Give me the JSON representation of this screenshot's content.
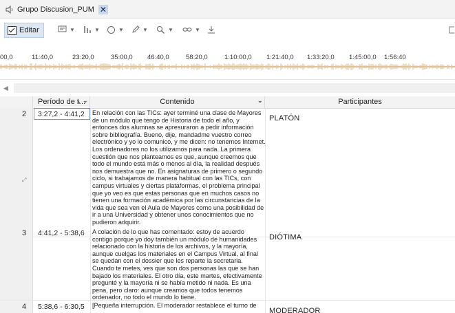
{
  "tab": {
    "title": "Grupo Discusion_PUM",
    "close": "✕"
  },
  "toolbar": {
    "edit_label": "Editar",
    "edit_checked": true,
    "icons": [
      "comment-icon",
      "bars-icon",
      "circle-icon",
      "pen-icon",
      "zoom-icon",
      "link-icon",
      "download-icon"
    ]
  },
  "timeline": {
    "ticks": [
      "00,0",
      "11:40,0",
      "23:20,0",
      "35:00,0",
      "46:40,0",
      "58:20,0",
      "1:10:00,0",
      "1:21:40,0",
      "1:33:20,0",
      "1:45:00,0",
      "1:56:40"
    ]
  },
  "table": {
    "headers": {
      "num": "",
      "period": "Período de t...",
      "content": "Contenido",
      "participants": "Participantes"
    },
    "rows": [
      {
        "num": "2",
        "period": "3:27,2 - 4:41,2",
        "content": "En relación con las TICs: ayer terminé una clase de Mayores de un módulo que tengo de Historia de todo el año, y entonces dos alumnas se apresuraron a pedir información sobre bibliografía. Bueno, dije, mandadme vuestro correo electrónico y yo lo comunico, y me dicen: no tenemos Internet. Los ordenadores no los utilizamos para nada. La primera cuestión que nos planteamos es que, aunque creemos que todo el mundo está más o menos al día, la realidad después nos demuestra que no. En asignaturas de primero o segundo ciclo, si trabajamos de manera habitual con las TICs, con campus virtuales y ciertas plataformas, el problema principal que yo veo es que estas personas que en muchos casos no tienen una formación académica por las circunstancias de la vida que sea ven el Aula de Mayores como una posibilidad de ir a una Universidad y obtener unos conocimientos que no pudieron adquirir.",
        "participant": "PLATÓN"
      },
      {
        "num": "3",
        "period": "4:41,2 - 5:38,6",
        "content": "A colación de lo que has comentado: estoy de acuerdo contigo porque yo doy también un módulo de humanidades relacionado con la historia de los archivos, y la mayoría, aunque cuelgas los materiales en el Campus Virtual, al final se quedan con el dossier que les reparte la secretaria. Cuando te metes, ves que son dos personas las que se han bajado los materiales. El otro día, este martes, efectivamente pregunté y la mayoría ni se había metido ni nada. Es una pena, pero claro: aunque creamos que todos tenemos ordenador, no todo el mundo lo tiene.",
        "participant": "DIÓTIMA"
      },
      {
        "num": "4",
        "period": "5:38,6 - 6:30,5",
        "content": "[Pequeña interrupción. El moderador restablece el turno de",
        "participant": "MODERADOR"
      }
    ]
  },
  "colors": {
    "header_bg": "#f3f3f3",
    "selection": "#6b8fc7",
    "wave": "#c08a3a"
  }
}
